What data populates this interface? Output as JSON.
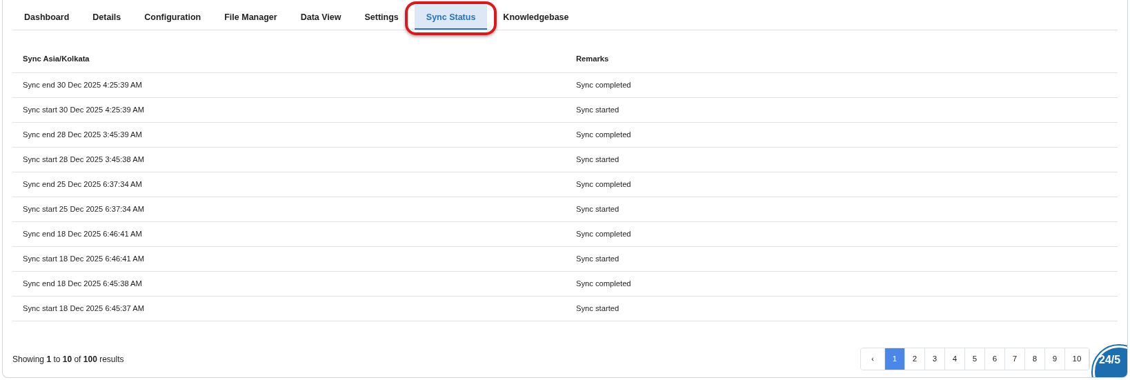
{
  "tabs": [
    {
      "label": "Dashboard",
      "selected": false
    },
    {
      "label": "Details",
      "selected": false
    },
    {
      "label": "Configuration",
      "selected": false
    },
    {
      "label": "File Manager",
      "selected": false
    },
    {
      "label": "Data View",
      "selected": false
    },
    {
      "label": "Settings",
      "selected": false
    },
    {
      "label": "Sync Status",
      "selected": true,
      "circled": true
    },
    {
      "label": "Knowledgebase",
      "selected": false
    }
  ],
  "table": {
    "columns": [
      "Sync Asia/Kolkata",
      "Remarks"
    ],
    "rows": [
      [
        "Sync end 30 Dec 2025 4:25:39 AM",
        "Sync completed"
      ],
      [
        "Sync start 30 Dec 2025 4:25:39 AM",
        "Sync started"
      ],
      [
        "Sync end 28 Dec 2025 3:45:39 AM",
        "Sync completed"
      ],
      [
        "Sync start 28 Dec 2025 3:45:38 AM",
        "Sync started"
      ],
      [
        "Sync end 25 Dec 2025 6:37:34 AM",
        "Sync completed"
      ],
      [
        "Sync start 25 Dec 2025 6:37:34 AM",
        "Sync started"
      ],
      [
        "Sync end 18 Dec 2025 6:46:41 AM",
        "Sync completed"
      ],
      [
        "Sync start 18 Dec 2025 6:46:41 AM",
        "Sync started"
      ],
      [
        "Sync end 18 Dec 2025 6:45:38 AM",
        "Sync completed"
      ],
      [
        "Sync start 18 Dec 2025 6:45:37 AM",
        "Sync started"
      ]
    ]
  },
  "summary": "Showing **1** to **10** of **100** results",
  "pagination": {
    "prev": "‹",
    "pages": [
      {
        "label": "1",
        "selected": true
      },
      {
        "label": "2",
        "selected": false
      },
      {
        "label": "3",
        "selected": false
      },
      {
        "label": "4",
        "selected": false
      },
      {
        "label": "5",
        "selected": false
      },
      {
        "label": "6",
        "selected": false
      },
      {
        "label": "7",
        "selected": false
      },
      {
        "label": "8",
        "selected": false
      },
      {
        "label": "9",
        "selected": false
      },
      {
        "label": "10",
        "selected": false
      }
    ]
  },
  "support_badge": {
    "label": "24/5"
  }
}
